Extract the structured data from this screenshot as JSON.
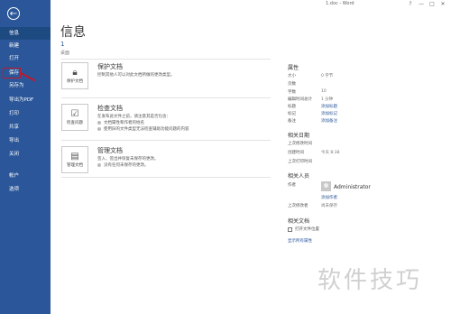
{
  "window": {
    "title": "1.doc - Word",
    "controls": [
      "?",
      "—",
      "□",
      "✕"
    ]
  },
  "sidebar": {
    "back_icon": "←",
    "items": [
      {
        "label": "信息",
        "active": true
      },
      {
        "label": "新建"
      },
      {
        "label": "打开"
      },
      {
        "label": "保存"
      },
      {
        "label": "另存为"
      },
      {
        "label": "导出为PDF"
      },
      {
        "label": "打印"
      },
      {
        "label": "共享"
      },
      {
        "label": "导出"
      },
      {
        "label": "关闭"
      },
      {
        "label": "帐户"
      },
      {
        "label": "选项"
      }
    ]
  },
  "main": {
    "title": "信息",
    "count": "1",
    "count_label": "桌面",
    "sections": [
      {
        "button_label": "保护文档",
        "heading": "保护文档",
        "lines": [
          "控制其他人可以对此文档所做的更改类型。"
        ]
      },
      {
        "button_label": "检查问题",
        "heading": "检查文档",
        "lines": [
          "在发布此文件之前，请注意其是否包含：",
          "文档属性和作者的姓名",
          "使用旧的文件类型无法检查辅助功能问题的内容"
        ]
      },
      {
        "button_label": "管理文档",
        "heading": "管理文档",
        "lines": [
          "签入、签出并恢复未保存的更改。",
          "没有任何未保存的更改。"
        ]
      }
    ]
  },
  "properties": {
    "title": "属性",
    "rows": [
      {
        "label": "大小",
        "value": "0 字节"
      },
      {
        "label": "页数",
        "value": ""
      },
      {
        "label": "字数",
        "value": "10"
      },
      {
        "label": "编辑时间总计",
        "value": "1 分钟"
      },
      {
        "label": "标题",
        "value": "添加标题"
      },
      {
        "label": "标记",
        "value": "添加标记"
      },
      {
        "label": "备注",
        "value": "添加备注"
      }
    ],
    "dates_title": "相关日期",
    "dates": [
      {
        "label": "上次修改时间",
        "value": ""
      },
      {
        "label": "创建时间",
        "value": "今天 8:38"
      },
      {
        "label": "上次打印时间",
        "value": ""
      }
    ],
    "people_title": "相关人员",
    "author_label": "作者",
    "author_name": "Administrator",
    "add_author": "添加作者",
    "last_modified_by_label": "上次修改者",
    "last_modified_by_value": "尚未保存",
    "docs_title": "相关文档",
    "open_location": "打开文件位置",
    "show_all": "显示所有属性"
  },
  "watermark": "软件技巧",
  "colors": {
    "sidebar": "#2b579a",
    "highlight": "#c0182a"
  }
}
